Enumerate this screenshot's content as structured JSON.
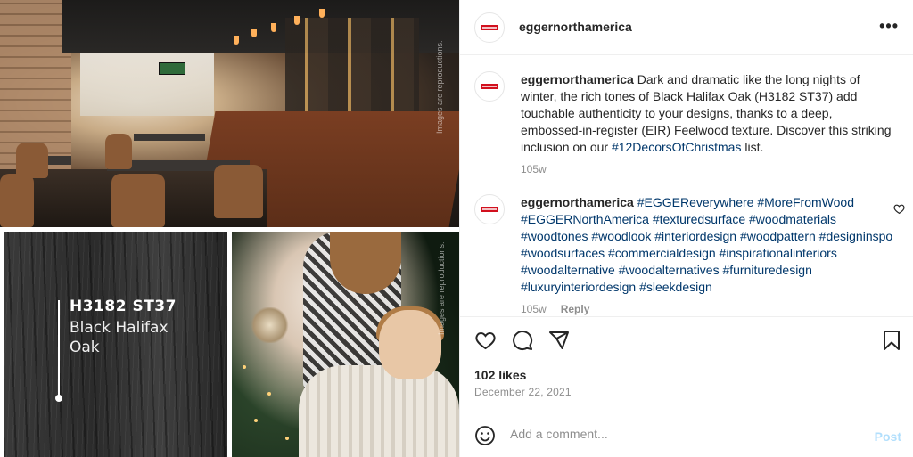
{
  "media": {
    "product_code": "H3182   ST37",
    "product_name": "Black Halifax Oak",
    "disclaimer": "Images are reproductions."
  },
  "post": {
    "username": "eggernorthamerica",
    "more_icon": "more-horizontal-icon"
  },
  "caption": {
    "username": "eggernorthamerica",
    "text": "Dark and dramatic like the long nights of winter, the rich tones of Black Halifax Oak (H3182 ST37) add touchable authenticity to your designs, thanks to a deep, embossed-in-register (EIR) Feelwood texture. Discover this striking inclusion on our ",
    "hashtag": "#12DecorsOfChristmas",
    "suffix": " list.",
    "time": "105w"
  },
  "comment": {
    "username": "eggernorthamerica",
    "hashtags": "#EGGEReverywhere #MoreFromWood #EGGERNorthAmerica #texturedsurface #woodmaterials #woodtones #woodlook #interiordesign #woodpattern #designinspo #woodsurfaces #commercialdesign #inspirationalinteriors #woodalternative #woodalternatives #furnituredesign #luxuryinteriordesign #sleekdesign",
    "time": "105w",
    "reply_label": "Reply"
  },
  "stats": {
    "likes": "102 likes",
    "date": "December 22, 2021"
  },
  "add_comment": {
    "placeholder": "Add a comment...",
    "post_label": "Post"
  },
  "colors": {
    "brand_red": "#d2101e",
    "hashtag_blue": "#00376b",
    "post_disabled": "#b2dffc"
  }
}
